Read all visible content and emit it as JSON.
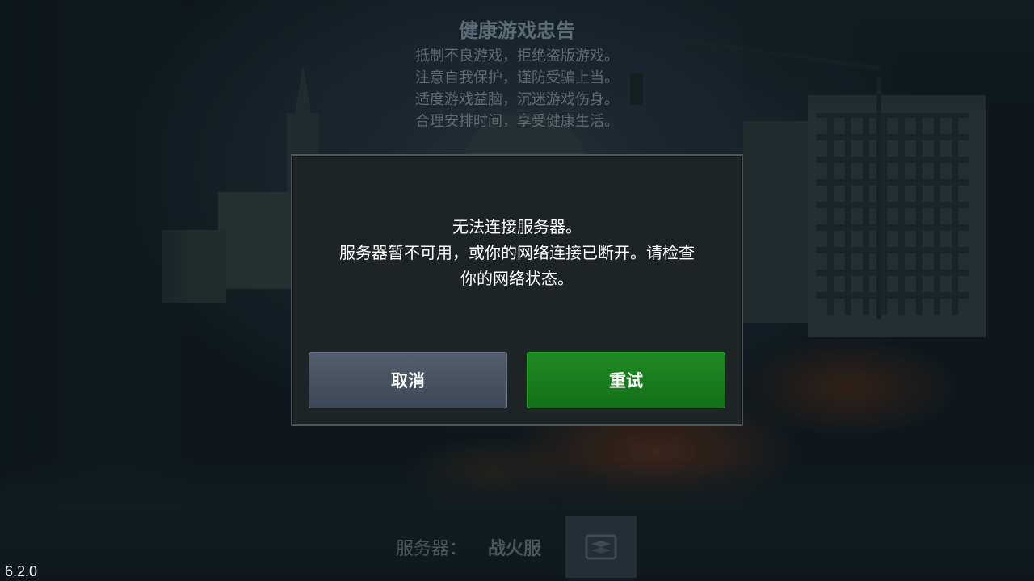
{
  "advisory": {
    "title": "健康游戏忠告",
    "lines": [
      "抵制不良游戏，拒绝盗版游戏。",
      "注意自我保护，谨防受骗上当。",
      "适度游戏益脑，沉迷游戏伤身。",
      "合理安排时间，享受健康生活。"
    ]
  },
  "dialog": {
    "message_lines": [
      "无法连接服务器。",
      "服务器暂不可用，或你的网络连接已断开。请检查",
      "你的网络状态。"
    ],
    "cancel_label": "取消",
    "retry_label": "重试"
  },
  "footer": {
    "server_label": "服务器：",
    "server_name": "战火服",
    "server_icon": "server-select-icon",
    "version": "6.2.0"
  },
  "colors": {
    "dialog_bg": "#1e2426",
    "cancel_button": "#465162",
    "retry_button": "#1a7e1f"
  }
}
